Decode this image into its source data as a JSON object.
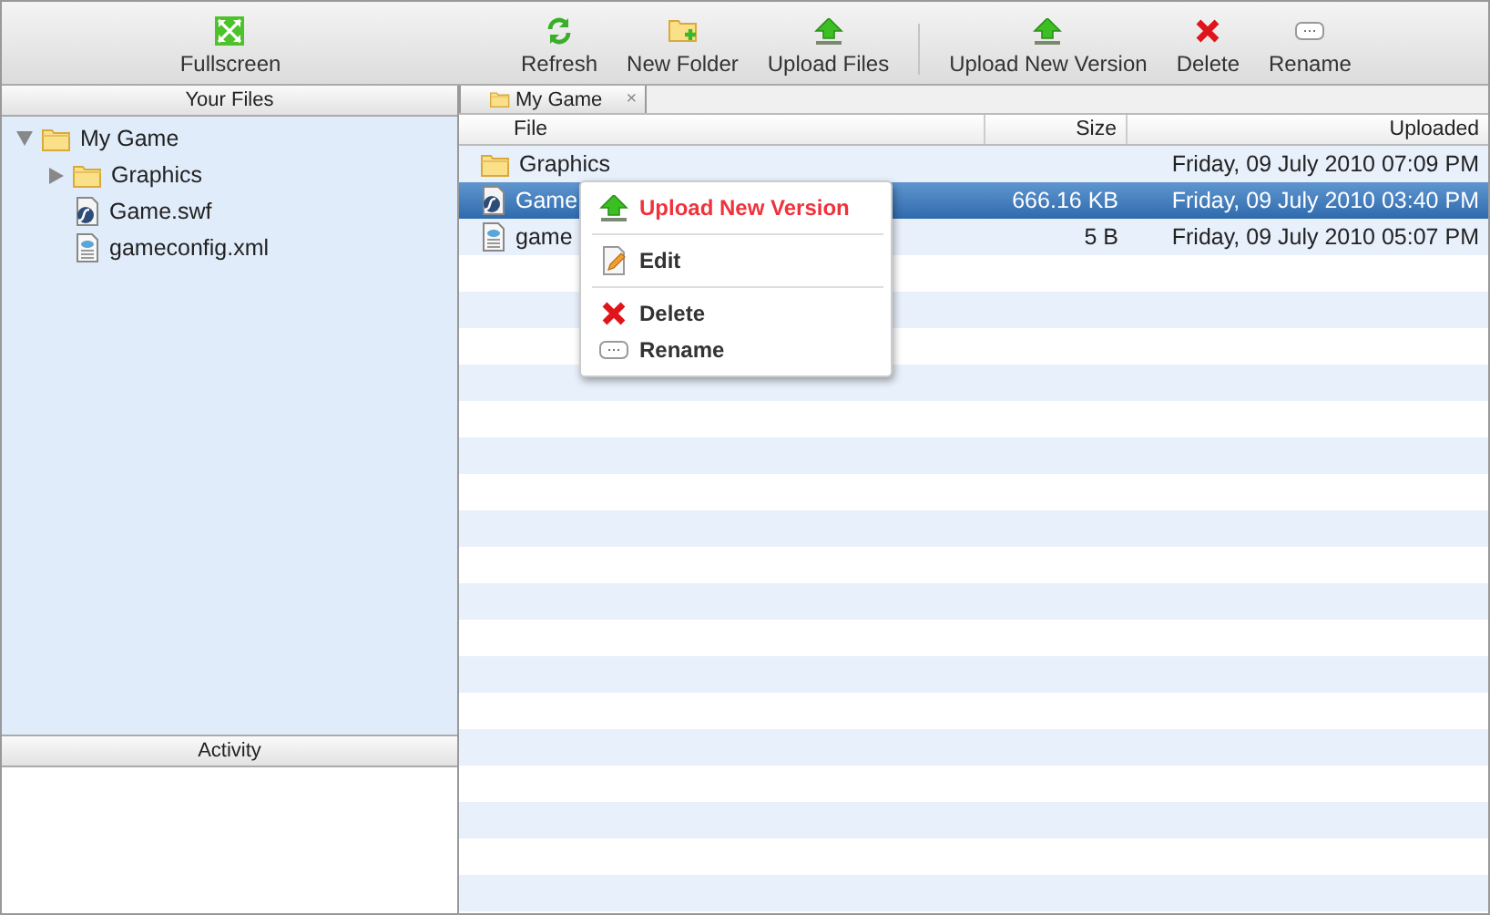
{
  "toolbar": {
    "groups": [
      {
        "buttons": [
          {
            "label": "Fullscreen"
          }
        ]
      },
      {
        "buttons": [
          {
            "label": "Refresh"
          },
          {
            "label": "New Folder"
          },
          {
            "label": "Upload Files"
          }
        ]
      },
      {
        "buttons": [
          {
            "label": "Upload New Version"
          },
          {
            "label": "Delete"
          },
          {
            "label": "Rename"
          }
        ]
      }
    ]
  },
  "sidebar": {
    "title": "Your Files",
    "tree": [
      {
        "label": "My Game",
        "kind": "folder",
        "expanded": true,
        "children": [
          {
            "label": "Graphics",
            "kind": "folder",
            "expanded": false
          },
          {
            "label": "Game.swf",
            "kind": "swf"
          },
          {
            "label": "gameconfig.xml",
            "kind": "xml"
          }
        ]
      }
    ]
  },
  "activity": {
    "title": "Activity"
  },
  "tabs": [
    {
      "label": "My Game",
      "selected": true,
      "close": "×"
    }
  ],
  "table": {
    "columns": [
      "File",
      "Size",
      "Uploaded"
    ],
    "rows": [
      {
        "kind": "folder",
        "name": "Graphics",
        "size": "",
        "uploaded": "Friday, 09 July 2010 07:09 PM",
        "selected": false
      },
      {
        "kind": "swf",
        "name": "Game",
        "size": "666.16 KB",
        "uploaded": "Friday, 09 July 2010 03:40 PM",
        "selected": true
      },
      {
        "kind": "xml",
        "name": "game",
        "size": "5 B",
        "uploaded": "Friday, 09 July 2010 05:07 PM",
        "selected": false
      }
    ]
  },
  "context_menu": {
    "items": [
      {
        "kind": "upload",
        "label": "Upload New Version",
        "highlighted": true
      },
      {
        "kind": "edit",
        "label": "Edit",
        "highlighted": false
      },
      {
        "kind": "delete",
        "label": "Delete",
        "highlighted": false
      },
      {
        "kind": "rename",
        "label": "Rename",
        "highlighted": false
      }
    ]
  }
}
